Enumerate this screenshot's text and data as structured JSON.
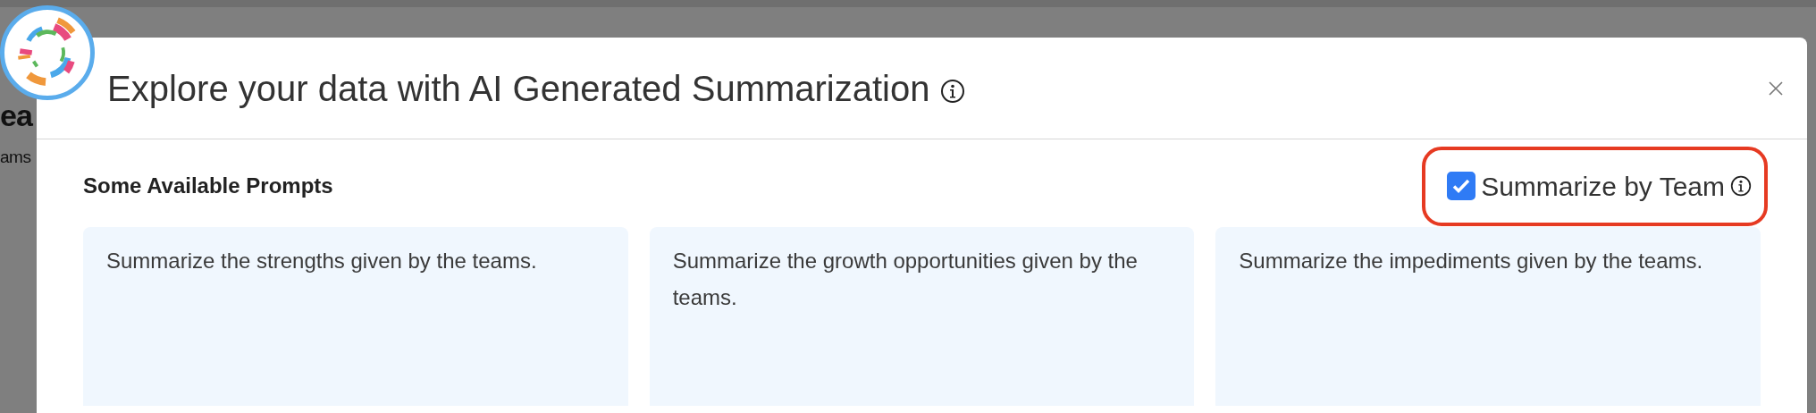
{
  "background": {
    "heading": "ea",
    "subtext": "ams"
  },
  "modal": {
    "title": "Explore your data with AI Generated Summarization",
    "section_title": "Some Available Prompts",
    "option": {
      "label": "Summarize by Team",
      "checked": true,
      "highlighted": true
    },
    "prompts": [
      {
        "text": "Summarize the strengths given by the teams."
      },
      {
        "text": "Summarize the growth opportunities given by the teams."
      },
      {
        "text": "Summarize the impediments given by the teams."
      }
    ]
  }
}
